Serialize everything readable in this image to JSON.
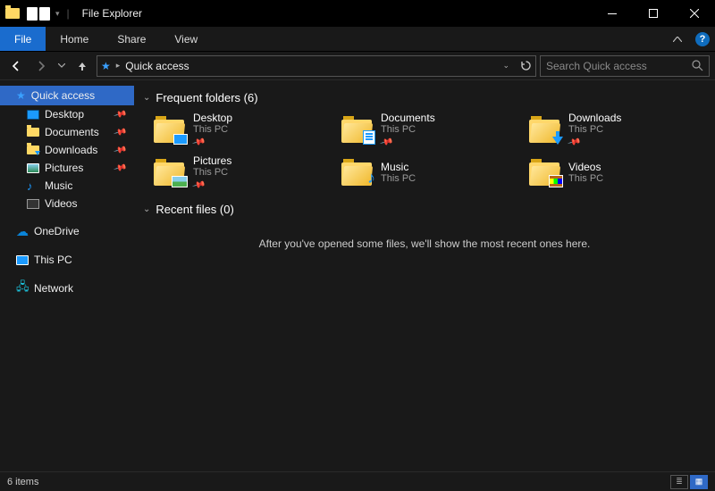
{
  "window": {
    "title": "File Explorer"
  },
  "ribbon": {
    "file": "File",
    "home": "Home",
    "share": "Share",
    "view": "View"
  },
  "address": {
    "crumb": "Quick access"
  },
  "search": {
    "placeholder": "Search Quick access"
  },
  "navpane": {
    "quick_access": "Quick access",
    "items": [
      {
        "label": "Desktop"
      },
      {
        "label": "Documents"
      },
      {
        "label": "Downloads"
      },
      {
        "label": "Pictures"
      },
      {
        "label": "Music"
      },
      {
        "label": "Videos"
      }
    ],
    "onedrive": "OneDrive",
    "thispc": "This PC",
    "network": "Network"
  },
  "content": {
    "group_folders": "Frequent folders (6)",
    "group_recent": "Recent files (0)",
    "folders": [
      {
        "name": "Desktop",
        "sub": "This PC"
      },
      {
        "name": "Documents",
        "sub": "This PC"
      },
      {
        "name": "Downloads",
        "sub": "This PC"
      },
      {
        "name": "Pictures",
        "sub": "This PC"
      },
      {
        "name": "Music",
        "sub": "This PC"
      },
      {
        "name": "Videos",
        "sub": "This PC"
      }
    ],
    "empty_recent": "After you've opened some files, we'll show the most recent ones here."
  },
  "statusbar": {
    "count": "6 items"
  }
}
